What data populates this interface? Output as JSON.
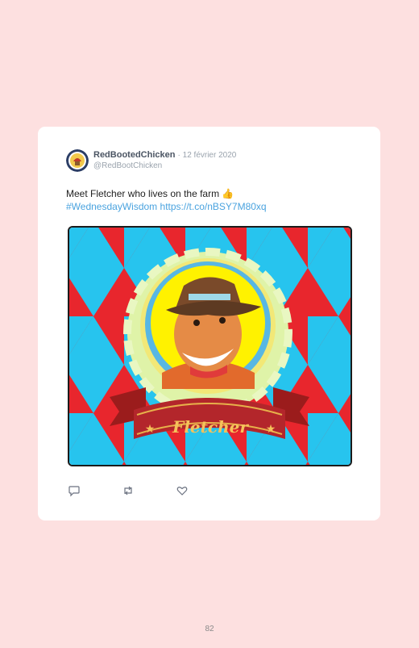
{
  "tweet": {
    "display_name": "RedBootedChicken",
    "date": "· 12 février 2020",
    "handle": "@RedBootChicken",
    "text_main": "Meet Fletcher who lives on the farm 👍",
    "hashtag": "#WednesdayWisdom",
    "url": "https://t.co/nBSY7M80xq",
    "image_caption": "Fletcher"
  },
  "actions": {
    "reply_icon": "reply-icon",
    "retweet_icon": "retweet-icon",
    "like_icon": "heart-icon"
  },
  "page": {
    "number": "82"
  },
  "colors": {
    "background": "#fde0e0",
    "card": "#ffffff",
    "link": "#4aa3df"
  }
}
